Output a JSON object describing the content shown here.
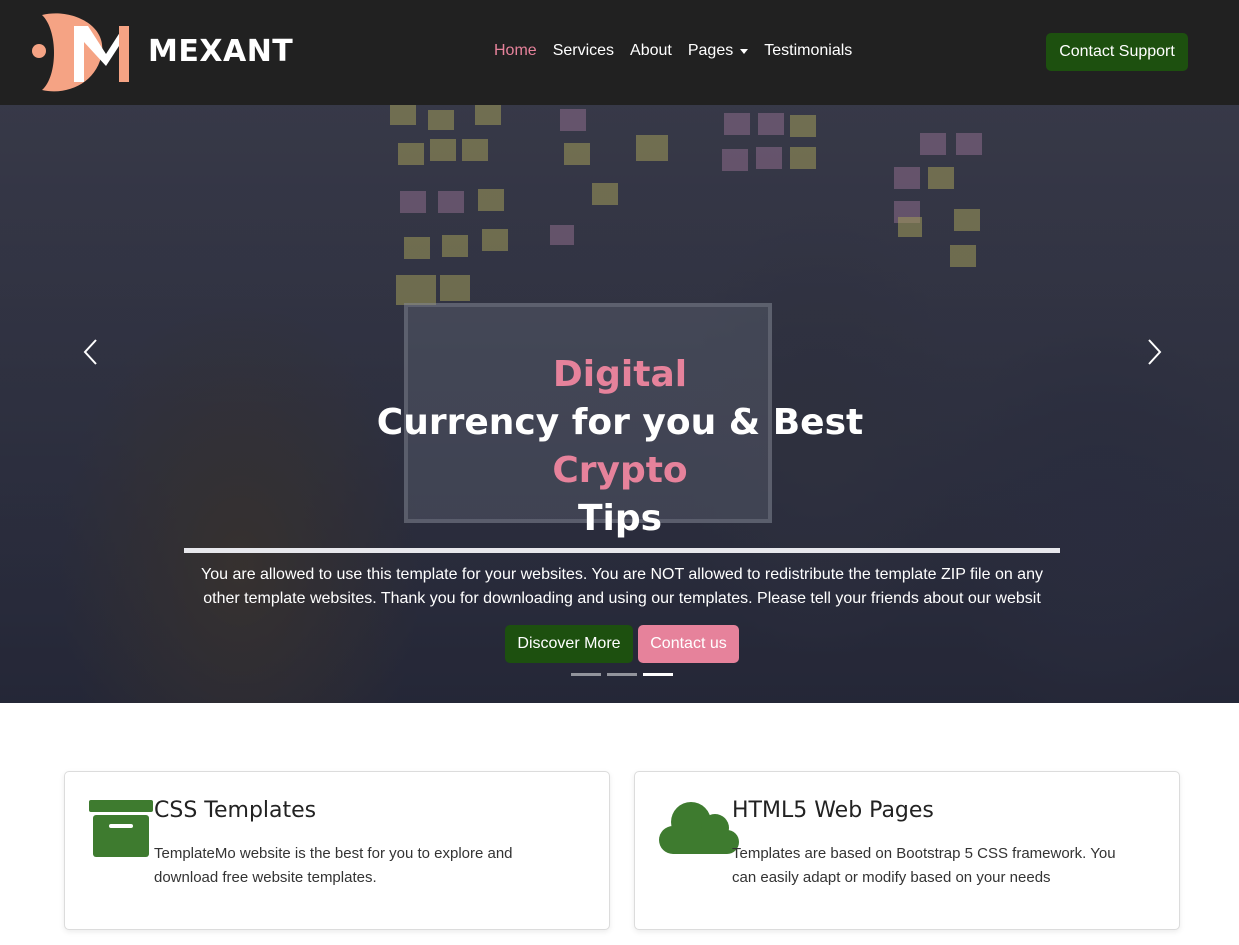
{
  "header": {
    "brand": "MEXANT",
    "nav": [
      {
        "label": "Home",
        "active": true
      },
      {
        "label": "Services"
      },
      {
        "label": "About"
      },
      {
        "label": "Pages",
        "dropdown": true
      },
      {
        "label": "Testimonials"
      }
    ],
    "support_button": "Contact Support"
  },
  "hero": {
    "title": {
      "line1": "Digital",
      "line2": "Currency for you & Best",
      "line3": "Crypto",
      "line4": "Tips"
    },
    "text": "You are allowed to use this template for your websites. You are NOT allowed to redistribute the template ZIP file on any other template websites. Thank you for downloading and using our templates. Please tell your friends about our websit",
    "primary_button": "Discover More",
    "secondary_button": "Contact us",
    "slides": 3,
    "active_slide": 3
  },
  "features": [
    {
      "icon": "archive-box-icon",
      "title": "CSS Templates",
      "text": "TemplateMo website is the best for you to explore and download free website templates."
    },
    {
      "icon": "cloud-icon",
      "title": "HTML5 Web Pages",
      "text": "Templates are based on Bootstrap 5 CSS framework. You can easily adapt or modify based on your needs"
    }
  ],
  "colors": {
    "navbar_bg": "#212121",
    "accent_pink": "#e6829b",
    "accent_green": "#1d500f",
    "icon_green": "#3e7b2f",
    "logo_peach": "#f5a384"
  }
}
